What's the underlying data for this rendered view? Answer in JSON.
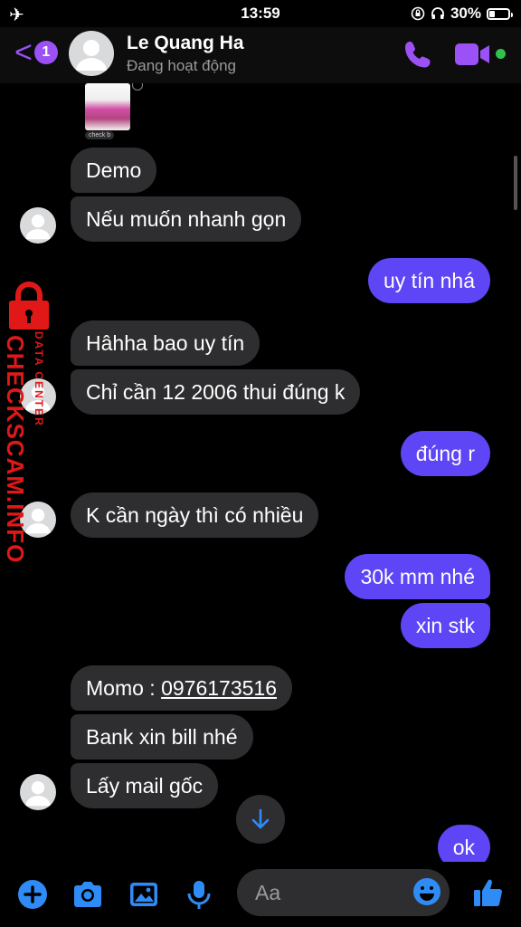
{
  "status_bar": {
    "time": "13:59",
    "battery": "30%",
    "battery_level": 0.3
  },
  "header": {
    "back_badge": "1",
    "contact_name": "Le Quang Ha",
    "presence": "Đang hoạt động"
  },
  "watermark": {
    "brand": "CHECKSCAM.INFO",
    "tagline": "DATA CENTER"
  },
  "attachment": {
    "label": "check b"
  },
  "messages": [
    {
      "side": "in",
      "text": "Demo"
    },
    {
      "side": "in",
      "text": "Nếu muốn nhanh gọn"
    },
    {
      "side": "out",
      "text": "uy tín nhá"
    },
    {
      "side": "in",
      "text": "Hâhha bao uy tín"
    },
    {
      "side": "in",
      "text": "Chỉ cần 12 2006 thui đúng k"
    },
    {
      "side": "out",
      "text": "đúng r"
    },
    {
      "side": "in",
      "text": "K cần ngày thì có nhiều"
    },
    {
      "side": "out",
      "text": "30k mm nhé"
    },
    {
      "side": "out",
      "text": "xin stk"
    },
    {
      "side": "in",
      "text_prefix": "Momo : ",
      "phone": "0976173516"
    },
    {
      "side": "in",
      "text": "Bank xin bill nhé"
    },
    {
      "side": "in",
      "text": "Lấy mail gốc"
    },
    {
      "side": "out",
      "text": "ok"
    }
  ],
  "composer": {
    "placeholder": "Aa"
  },
  "colors": {
    "accent": "#9b51f5",
    "outgoing": "#5e45f5",
    "incoming": "#2e2e30",
    "icon_blue": "#2f8cf6",
    "online": "#31c24d",
    "watermark": "#e01818"
  },
  "icons": [
    "airplane-icon",
    "rotation-lock-icon",
    "headphones-icon",
    "battery-icon",
    "back-chevron-icon",
    "phone-icon",
    "video-icon",
    "plus-icon",
    "camera-icon",
    "gallery-icon",
    "microphone-icon",
    "emoji-icon",
    "like-icon",
    "arrow-down-icon"
  ]
}
